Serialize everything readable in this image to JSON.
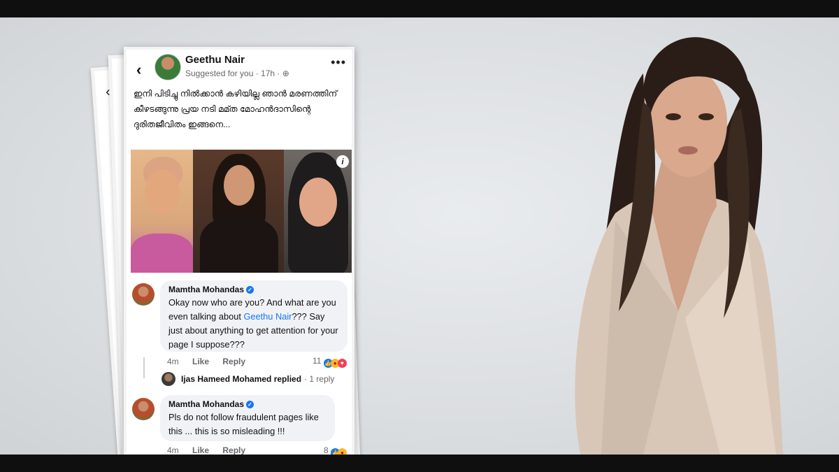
{
  "post": {
    "page_name": "Geethu Nair",
    "meta": "Suggested for you · 17h · ⊕",
    "caption": "ഇനി പിടിച്ചു നിൽക്കാൻ കഴിയില്ല ഞാൻ മരണത്തിന് കീഴടങ്ങുന്നു പ്രയ നടി മമ്ത മോഹൻദാസിന്റെ ദുരിതജീവിതം ഇങ്ങനെ...",
    "back_icon": "‹",
    "more_icon": "•••",
    "info_icon": "i"
  },
  "comments": [
    {
      "author": "Mamtha Mohandas",
      "text_before": "Okay now who are you? And what are you even talking about ",
      "link": "Geethu Nair",
      "text_after": "??? Say just about anything to get attention for your page I suppose???",
      "time": "4m",
      "like": "Like",
      "reply": "Reply",
      "reactions": "11"
    },
    {
      "author": "Mamtha Mohandas",
      "text": "Pls do not follow fraudulent pages like this ... this is so misleading !!!",
      "time": "4m",
      "like": "Like",
      "reply": "Reply",
      "reactions": "8"
    }
  ],
  "reply_thread": {
    "author": "Ijas Hameed Mohamed replied",
    "count": "· 1 reply"
  },
  "colors": {
    "accent": "#1877f2",
    "bubble": "#f0f2f5",
    "background": "#dcdfe2"
  }
}
